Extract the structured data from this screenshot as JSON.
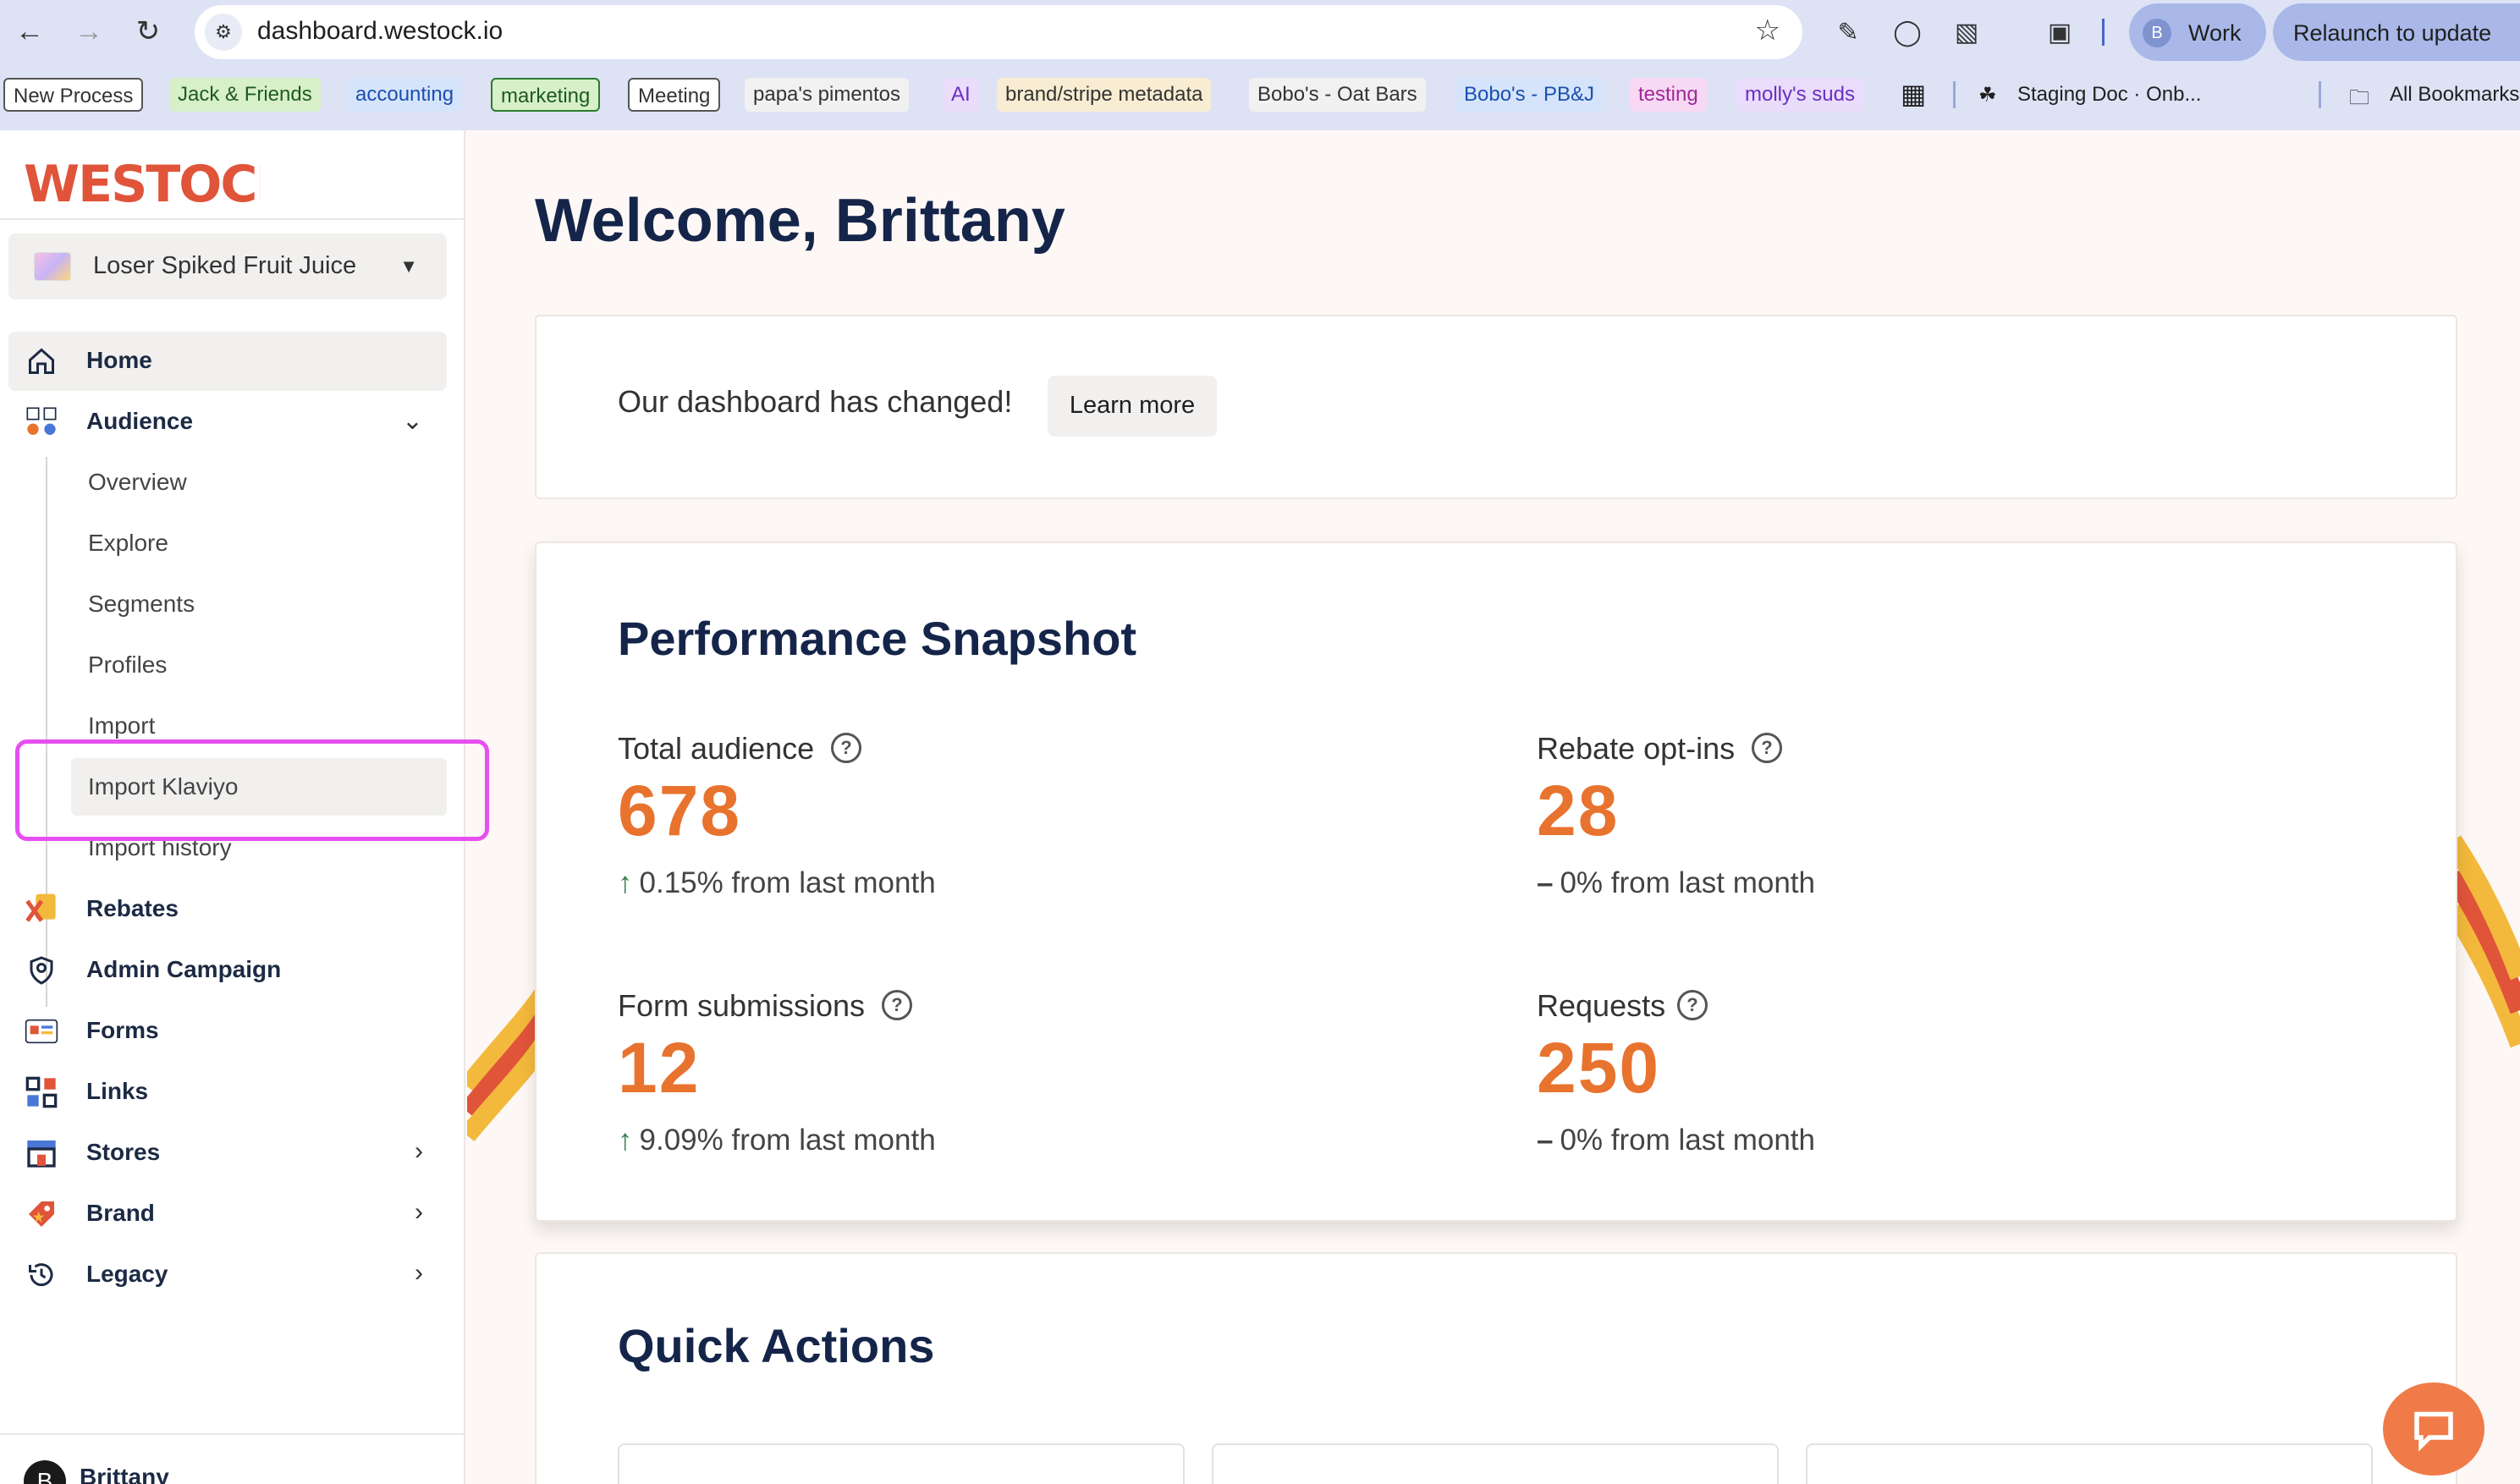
{
  "browser": {
    "url": "dashboard.westock.io",
    "profile_initial": "B",
    "profile_name": "Work",
    "relaunch_label": "Relaunch to update",
    "bookmarks": [
      {
        "label": "New Process",
        "bg": "#ffffff",
        "fg": "#333333",
        "border": "#555555"
      },
      {
        "label": "Jack & Friends",
        "bg": "#d7f0c9",
        "fg": "#1f5a1f",
        "border": "none"
      },
      {
        "label": "accounting",
        "bg": "#d6e4fb",
        "fg": "#1a4fb0",
        "border": "none"
      },
      {
        "label": "marketing",
        "bg": "#d7f0c9",
        "fg": "#1f5a1f",
        "border": "#2d7a2d"
      },
      {
        "label": "Meeting",
        "bg": "#ffffff",
        "fg": "#333333",
        "border": "#555555"
      },
      {
        "label": "papa's pimentos",
        "bg": "#f1f1f1",
        "fg": "#333333",
        "border": "none"
      },
      {
        "label": "AI",
        "bg": "#eadcfb",
        "fg": "#6a2fc0",
        "border": "none"
      },
      {
        "label": "brand/stripe metadata",
        "bg": "#f8ecd2",
        "fg": "#333333",
        "border": "none"
      },
      {
        "label": "Bobo's - Oat Bars",
        "bg": "#f1f1f1",
        "fg": "#333333",
        "border": "none"
      },
      {
        "label": "Bobo's - PB&J",
        "bg": "#d6e4fb",
        "fg": "#1a4fb0",
        "border": "none"
      },
      {
        "label": "testing",
        "bg": "#f7d9f3",
        "fg": "#a0289a",
        "border": "none"
      },
      {
        "label": "molly's suds",
        "bg": "#eadcfb",
        "fg": "#6a2fc0",
        "border": "none"
      }
    ],
    "staging_doc": "Staging Doc · Onb...",
    "all_bookmarks": "All Bookmarks"
  },
  "app": {
    "logo_text": "WESTOCK",
    "brand_select": "Loser Spiked Fruit Juice",
    "nav": {
      "home": "Home",
      "audience": "Audience",
      "rebates": "Rebates",
      "admin_campaign": "Admin Campaign",
      "forms": "Forms",
      "links": "Links",
      "stores": "Stores",
      "brand": "Brand",
      "legacy": "Legacy"
    },
    "audience_sub": {
      "overview": "Overview",
      "explore": "Explore",
      "segments": "Segments",
      "profiles": "Profiles",
      "import": "Import",
      "import_klaviyo": "Import Klaviyo",
      "import_history": "Import history"
    },
    "user": {
      "initial": "B",
      "name": "Brittany"
    }
  },
  "main": {
    "welcome": "Welcome, Brittany",
    "notice_text": "Our dashboard has changed!",
    "learn_more": "Learn more",
    "perf_title": "Performance Snapshot",
    "stats": {
      "total_audience": {
        "label": "Total audience",
        "value": "678",
        "arrow": "↑",
        "change": "0.15% from last month"
      },
      "rebate_optins": {
        "label": "Rebate opt-ins",
        "value": "28",
        "arrow": "–",
        "change": "0% from last month"
      },
      "form_submissions": {
        "label": "Form submissions",
        "value": "12",
        "arrow": "↑",
        "change": "9.09% from last month"
      },
      "requests": {
        "label": "Requests",
        "value": "250",
        "arrow": "–",
        "change": "0% from last month"
      }
    },
    "quick_actions_title": "Quick Actions"
  },
  "colors": {
    "accent_orange": "#e8732e",
    "navy": "#15254a",
    "highlight": "#e64ff0"
  }
}
